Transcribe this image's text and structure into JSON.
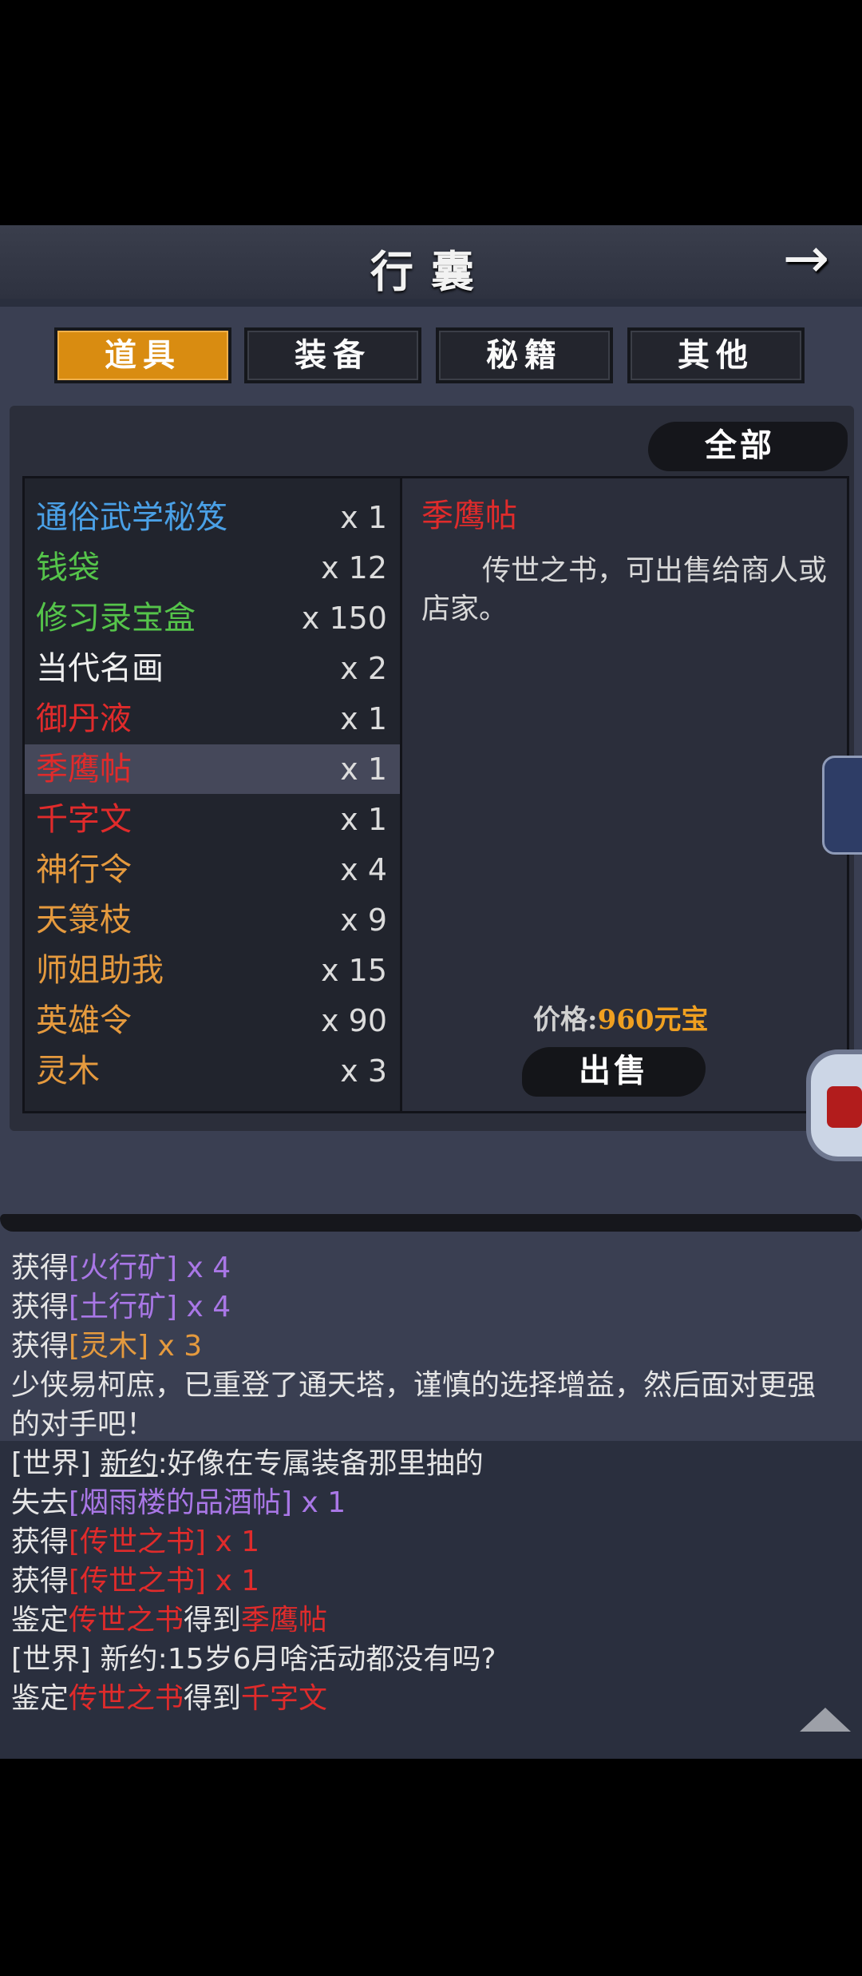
{
  "header": {
    "title": "行囊",
    "back_icon": "→"
  },
  "tabs": [
    {
      "label": "道具",
      "active": true
    },
    {
      "label": "装备",
      "active": false
    },
    {
      "label": "秘籍",
      "active": false
    },
    {
      "label": "其他",
      "active": false
    }
  ],
  "filter": {
    "label": "全部"
  },
  "items": [
    {
      "name": "通俗武学秘笈",
      "count": "x 1",
      "color": "#4aa0e6"
    },
    {
      "name": "钱袋",
      "count": "x 12",
      "color": "#55c44a"
    },
    {
      "name": "修习录宝盒",
      "count": "x 150",
      "color": "#55c44a"
    },
    {
      "name": "当代名画",
      "count": "x 2",
      "color": "#f0f0f0"
    },
    {
      "name": "御丹液",
      "count": "x 1",
      "color": "#e02b2b"
    },
    {
      "name": "季鹰帖",
      "count": "x 1",
      "color": "#e02b2b",
      "selected": true
    },
    {
      "name": "千字文",
      "count": "x 1",
      "color": "#e02b2b"
    },
    {
      "name": "神行令",
      "count": "x 4",
      "color": "#e59a3e"
    },
    {
      "name": "天箓枝",
      "count": "x 9",
      "color": "#e59a3e"
    },
    {
      "name": "师姐助我",
      "count": "x 15",
      "color": "#e59a3e"
    },
    {
      "name": "英雄令",
      "count": "x 90",
      "color": "#e59a3e"
    },
    {
      "name": "灵木",
      "count": "x 3",
      "color": "#e59a3e"
    }
  ],
  "detail": {
    "name": "季鹰帖",
    "description": "传世之书，可出售给商人或店家。",
    "price_label": "价格:",
    "price_value": "960元宝",
    "sell_label": "出售"
  },
  "log": {
    "l1a": "获得",
    "l1b": "[火行矿]",
    "l1c": " x 4",
    "l2a": "获得",
    "l2b": "[土行矿]",
    "l2c": " x 4",
    "l3a": "获得",
    "l3b": "[灵木]",
    "l3c": " x 3",
    "l4": "少侠易柯庶，已重登了通天塔，谨慎的选择增益，然后面对更强",
    "l5": "的对手吧！",
    "l6a": "[世界] ",
    "l6b": "新约",
    "l6c": ":好像在专属装备那里抽的",
    "l7a": "失去",
    "l7b": "[烟雨楼的品酒帖]",
    "l7c": " x 1",
    "l8a": "获得",
    "l8b": "[传世之书]",
    "l8c": " x 1",
    "l9a": "获得",
    "l9b": "[传世之书]",
    "l9c": " x 1",
    "l10a": "鉴定",
    "l10b": "传世之书",
    "l10c": "得到",
    "l10d": "季鹰帖",
    "l11a": "[世界] ",
    "l11b": "新约",
    "l11c": ":15岁6月啥活动都没有吗?",
    "l12a": "鉴定",
    "l12b": "传世之书",
    "l12c": "得到",
    "l12d": "千字文"
  }
}
